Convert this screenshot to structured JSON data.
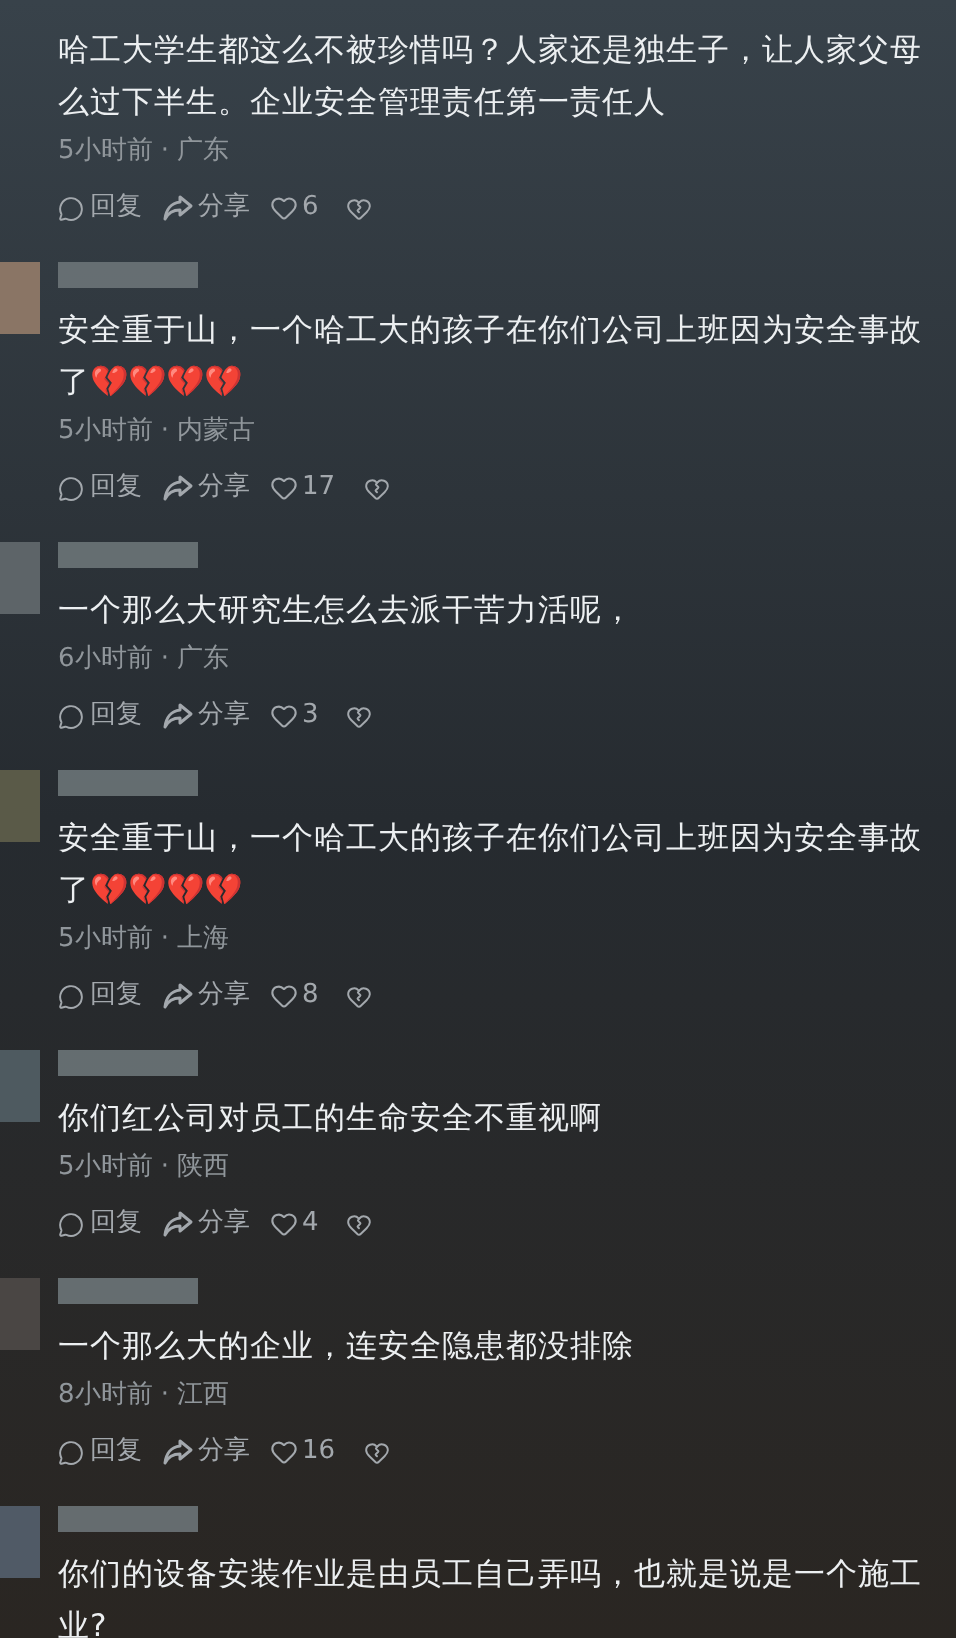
{
  "comments": [
    {
      "lines": [
        "哈工大学生都这么不被珍惜吗？人家还是独生子，让人家父母",
        "么过下半生。企业安全管理责任第一责任人"
      ],
      "meta": "5小时前 · 广东",
      "reply": "回复",
      "share": "分享",
      "likes": "6"
    },
    {
      "color": "#8a7565",
      "lines": [
        "安全重于山，一个哈工大的孩子在你们公司上班因为安全事故",
        "了💔💔💔💔"
      ],
      "meta": "5小时前 · 内蒙古",
      "reply": "回复",
      "share": "分享",
      "likes": "17"
    },
    {
      "color": "#5d6468",
      "lines": [
        "一个那么大研究生怎么去派干苦力活呢，"
      ],
      "meta": "6小时前 · 广东",
      "reply": "回复",
      "share": "分享",
      "likes": "3"
    },
    {
      "color": "#5a5a48",
      "lines": [
        "安全重于山，一个哈工大的孩子在你们公司上班因为安全事故",
        "了💔💔💔💔"
      ],
      "meta": "5小时前 · 上海",
      "reply": "回复",
      "share": "分享",
      "likes": "8"
    },
    {
      "color": "#4e5a60",
      "lines": [
        "你们红公司对员工的生命安全不重视啊"
      ],
      "meta": "5小时前 · 陕西",
      "reply": "回复",
      "share": "分享",
      "likes": "4"
    },
    {
      "color": "#4a4644",
      "lines": [
        "一个那么大的企业，连安全隐患都没排除"
      ],
      "meta": "8小时前 · 江西",
      "reply": "回复",
      "share": "分享",
      "likes": "16"
    },
    {
      "color": "#505a66",
      "lines": [
        "你们的设备安装作业是由员工自己弄吗，也就是说是一个施工",
        "业?"
      ]
    }
  ]
}
